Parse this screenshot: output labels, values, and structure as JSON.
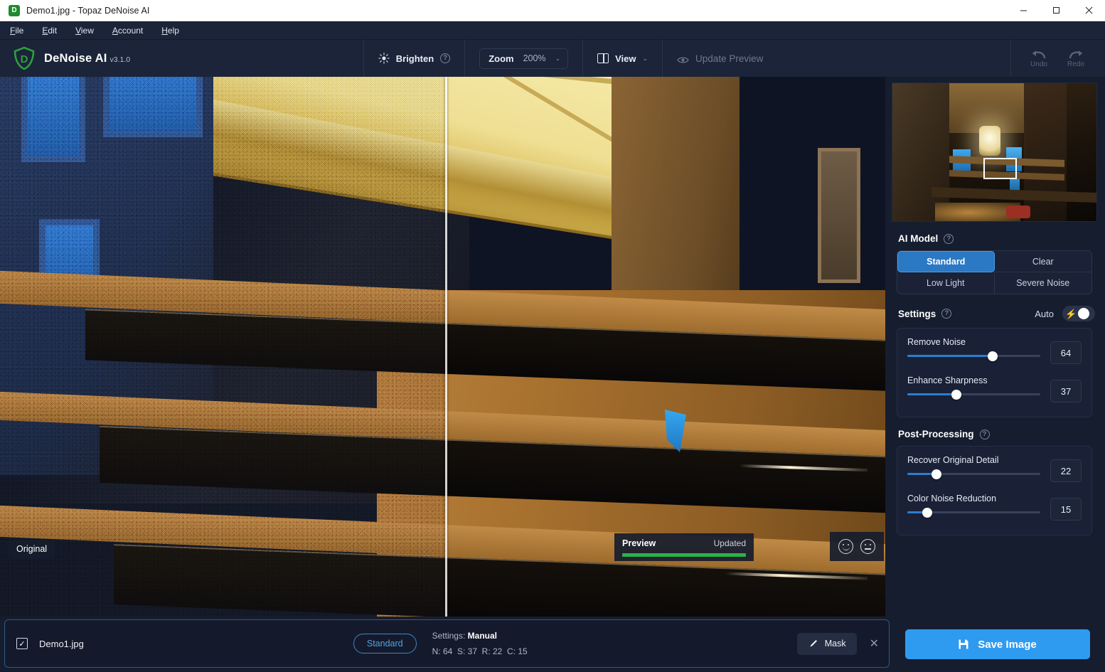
{
  "window": {
    "title": "Demo1.jpg - Topaz DeNoise AI",
    "app_icon": "topaz-shield-icon",
    "minimize": "—",
    "maximize": "☐",
    "close": "✕"
  },
  "menubar": {
    "items": [
      {
        "label": "File",
        "accel": "F"
      },
      {
        "label": "Edit",
        "accel": "E"
      },
      {
        "label": "View",
        "accel": "V"
      },
      {
        "label": "Account",
        "accel": "A"
      },
      {
        "label": "Help",
        "accel": "H"
      }
    ]
  },
  "brand": {
    "name": "DeNoise AI",
    "version": "v3.1.0"
  },
  "toolbar": {
    "brighten_label": "Brighten",
    "brighten_help": "?",
    "zoom_label": "Zoom",
    "zoom_value": "200%",
    "zoom_caret": "⌄",
    "view_label": "View",
    "view_caret": "⌄",
    "update_preview_label": "Update Preview",
    "undo_label": "Undo",
    "redo_label": "Redo"
  },
  "canvas": {
    "original_tag": "Original",
    "preview_title": "Preview",
    "preview_status": "Updated",
    "feedback_positive": "smiley-face-icon",
    "feedback_neutral": "neutral-face-icon"
  },
  "panel": {
    "ai_model": {
      "title": "AI Model",
      "help": "?",
      "options": [
        "Standard",
        "Clear",
        "Low Light",
        "Severe Noise"
      ],
      "selected": "Standard"
    },
    "settings": {
      "title": "Settings",
      "help": "?",
      "auto_label": "Auto",
      "auto_on": false,
      "sliders": [
        {
          "label": "Remove Noise",
          "value": 64,
          "percent": 64
        },
        {
          "label": "Enhance Sharpness",
          "value": 37,
          "percent": 37
        }
      ]
    },
    "post_processing": {
      "title": "Post-Processing",
      "help": "?",
      "sliders": [
        {
          "label": "Recover Original Detail",
          "value": 22,
          "percent": 22
        },
        {
          "label": "Color Noise Reduction",
          "value": 15,
          "percent": 15
        }
      ]
    }
  },
  "footer": {
    "filename": "Demo1.jpg",
    "checked": true,
    "model_pill": "Standard",
    "settings_line1_key": "Settings:",
    "settings_line1_val": "Manual",
    "settings_n": "N: 64",
    "settings_s": "S: 37",
    "settings_r": "R: 22",
    "settings_c": "C: 15",
    "mask_label": "Mask",
    "close_label": "✕",
    "save_label": "Save Image"
  },
  "colors": {
    "accent_blue": "#2e9bf0",
    "model_active": "#2b78c4",
    "progress_green": "#2bb24c",
    "panel_bg": "#161d2f",
    "toolbar_bg": "#1b2438",
    "brand_green": "#1f8a2e"
  }
}
